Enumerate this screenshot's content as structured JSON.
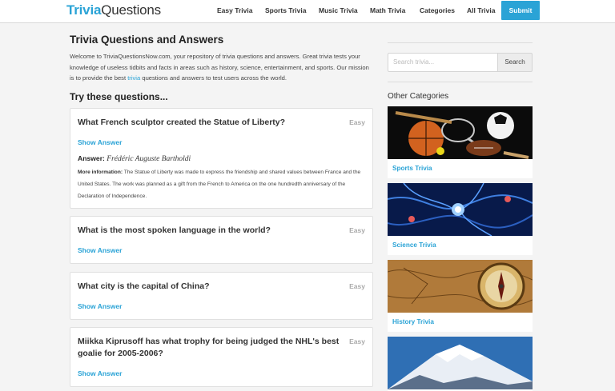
{
  "header": {
    "logo_accent": "Trivia",
    "logo_rest": "Questions",
    "nav": [
      "Easy Trivia",
      "Sports Trivia",
      "Music Trivia",
      "Math Trivia",
      "Categories",
      "All Trivia"
    ],
    "submit_label": "Submit",
    "accent_color": "#2aa3d6"
  },
  "main": {
    "title": "Trivia Questions and Answers",
    "intro_part1": "Welcome to TriviaQuestionsNow.com, your repository of trivia questions and answers. Great trivia tests your knowledge of useless tidbits and facts in areas such as history, science, entertainment, and sports. Our mission is to provide the best ",
    "intro_link": "trivia",
    "intro_part2": " questions and answers to test users across the world.",
    "section_title": "Try these questions...",
    "questions": [
      {
        "text": "What French sculptor created the Statue of Liberty?",
        "difficulty": "Easy",
        "show_answer": "Show Answer",
        "answer_label": "Answer:",
        "answer": "Frédéric Auguste Bartholdi",
        "more_label": "More information:",
        "more_text": "The Statue of Liberty was made to express the friendship and shared values between France and the United States. The work was planned as a gift from the French to America on the one hundredth anniversary of the Declaration of Independence."
      },
      {
        "text": "What is the most spoken language in the world?",
        "difficulty": "Easy",
        "show_answer": "Show Answer"
      },
      {
        "text": "What city is the capital of China?",
        "difficulty": "Easy",
        "show_answer": "Show Answer"
      },
      {
        "text": "Miikka Kiprusoff has what trophy for being judged the NHL's best goalie for 2005-2006?",
        "difficulty": "Easy",
        "show_answer": "Show Answer"
      }
    ]
  },
  "sidebar": {
    "search_placeholder": "Search trivia...",
    "search_button": "Search",
    "other_categories_title": "Other Categories",
    "categories": [
      {
        "label": "Sports Trivia",
        "icon": "sports-balls-image"
      },
      {
        "label": "Science Trivia",
        "icon": "neurons-image"
      },
      {
        "label": "History Trivia",
        "icon": "compass-map-image"
      },
      {
        "label": "",
        "icon": "snowy-mountain-image"
      }
    ]
  }
}
